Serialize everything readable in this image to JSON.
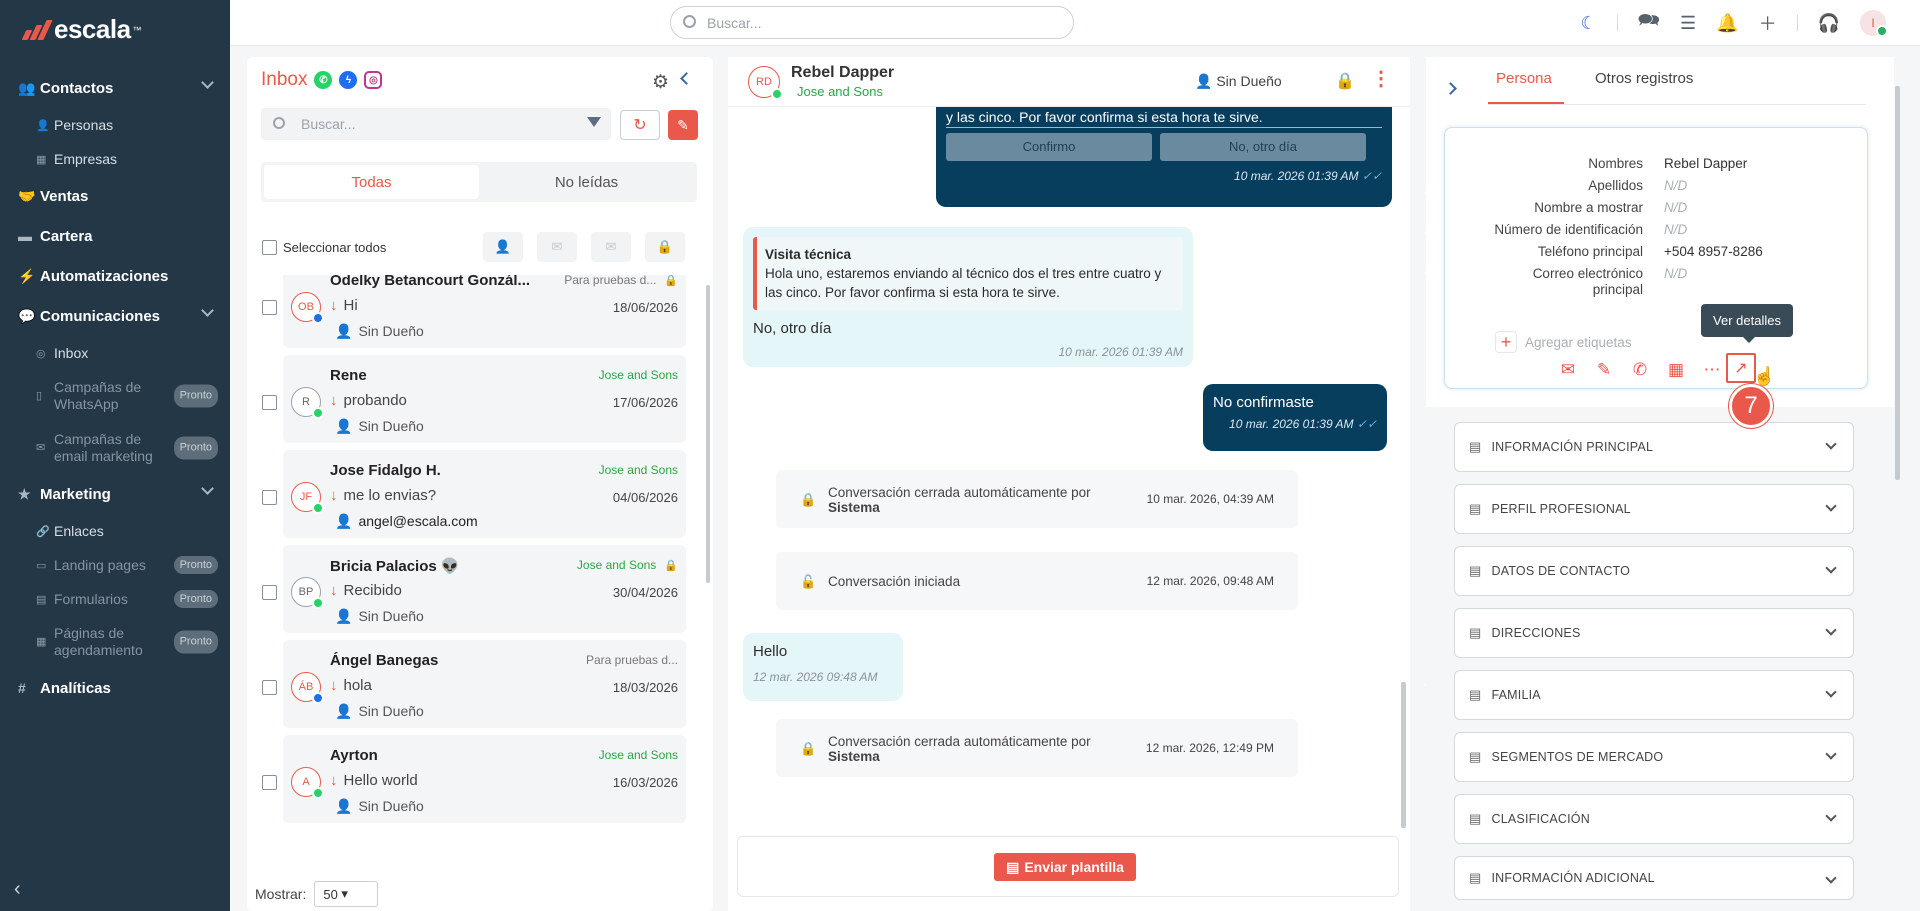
{
  "app": {
    "brand": "escala",
    "brand_mark": "™"
  },
  "colors": {
    "accent": "#e9584b",
    "sidebar": "#243747",
    "outgoing_bubble": "#073e5e",
    "incoming_bubble": "#e5f6f9",
    "success": "#28a745"
  },
  "sidebar": {
    "contactos": "Contactos",
    "personas": "Personas",
    "empresas": "Empresas",
    "ventas": "Ventas",
    "cartera": "Cartera",
    "automatizaciones": "Automatizaciones",
    "comunicaciones": "Comunicaciones",
    "inbox": "Inbox",
    "campanas_whatsapp": "Campañas de WhatsApp",
    "campanas_email": "Campañas de email marketing",
    "marketing": "Marketing",
    "enlaces": "Enlaces",
    "landing": "Landing pages",
    "formularios": "Formularios",
    "paginas": "Páginas de agendamiento",
    "analiticas": "Analíticas",
    "pronto": "Pronto"
  },
  "topbar": {
    "search_placeholder": "Buscar...",
    "user_initial": "I"
  },
  "inbox": {
    "title": "Inbox",
    "search_placeholder": "Buscar...",
    "tab_all": "Todas",
    "tab_unread": "No leídas",
    "select_all": "Seleccionar todos",
    "show_label": "Mostrar:",
    "show_value": "50",
    "conversations": [
      {
        "initials": "OB",
        "name": "Odelky Betancourt Gonzál...",
        "tag": "Para pruebas d...",
        "msg": "Hi",
        "date": "18/06/2026",
        "owner": "Sin Dueño"
      },
      {
        "initials": "R",
        "name": "Rene",
        "tag": "Jose and Sons",
        "msg": "probando",
        "date": "17/06/2026",
        "owner": "Sin Dueño"
      },
      {
        "initials": "JF",
        "name": "Jose Fidalgo H.",
        "tag": "Jose and Sons",
        "msg": "me lo envias?",
        "date": "04/06/2026",
        "owner": "angel@escala.com"
      },
      {
        "initials": "BP",
        "name": "Bricia Palacios 👽",
        "tag": "Jose and Sons",
        "msg": "Recibido",
        "date": "30/04/2026",
        "owner": "Sin Dueño"
      },
      {
        "initials": "ÁB",
        "name": "Ángel Banegas",
        "tag": "Para pruebas d...",
        "msg": "hola",
        "date": "18/03/2026",
        "owner": "Sin Dueño"
      },
      {
        "initials": "A",
        "name": "Ayrton",
        "tag": "Jose and Sons",
        "msg": "Hello world",
        "date": "16/03/2026",
        "owner": "Sin Dueño"
      }
    ]
  },
  "chat": {
    "contact_initials": "RD",
    "contact_name": "Rebel Dapper",
    "company": "Jose and Sons",
    "owner": "Sin Dueño",
    "msg1_text": "y las cinco. Por favor confirma si esta hora te sirve.",
    "msg1_btn1": "Confirmo",
    "msg1_btn2": "No, otro día",
    "msg1_time": "10 mar. 2026 01:39 AM",
    "quote_title": "Visita técnica",
    "quote_text": "Hola uno,  estaremos enviando al técnico dos el tres entre cuatro y las cinco. Por favor confirma si esta hora te sirve.",
    "msg2_text": "No, otro día",
    "msg2_time": "10 mar. 2026 01:39 AM",
    "msg3_text": "No confirmaste",
    "msg3_time": "10 mar. 2026 01:39 AM",
    "sys1_text": "Conversación cerrada automáticamente por",
    "sys1_by": "Sistema",
    "sys1_time": "10 mar. 2026, 04:39 AM",
    "sys2_text": "Conversación iniciada",
    "sys2_time": "12 mar. 2026, 09:48 AM",
    "msg4_text": "Hello",
    "msg4_time": "12 mar. 2026 09:48 AM",
    "sys3_text": "Conversación cerrada automáticamente por",
    "sys3_by": "Sistema",
    "sys3_time": "12 mar. 2026, 12:49 PM",
    "template_button": "Enviar plantilla"
  },
  "detail": {
    "tab_persona": "Persona",
    "tab_otros": "Otros registros",
    "fields": [
      {
        "label": "Nombres",
        "value": "Rebel Dapper"
      },
      {
        "label": "Apellidos",
        "value": "N/D"
      },
      {
        "label": "Nombre a mostrar",
        "value": "N/D"
      },
      {
        "label": "Número de identificación",
        "value": "N/D"
      },
      {
        "label": "Teléfono principal",
        "value": "+504 8957-8286"
      },
      {
        "label": "Correo electrónico principal",
        "value": "N/D"
      }
    ],
    "add_tags": "Agregar etiquetas",
    "tooltip": "Ver detalles",
    "step": "7",
    "sections": [
      "INFORMACIÓN PRINCIPAL",
      "PERFIL PROFESIONAL",
      "DATOS DE CONTACTO",
      "DIRECCIONES",
      "FAMILIA",
      "SEGMENTOS DE MERCADO",
      "CLASIFICACIÓN",
      "INFORMACIÓN ADICIONAL"
    ]
  }
}
